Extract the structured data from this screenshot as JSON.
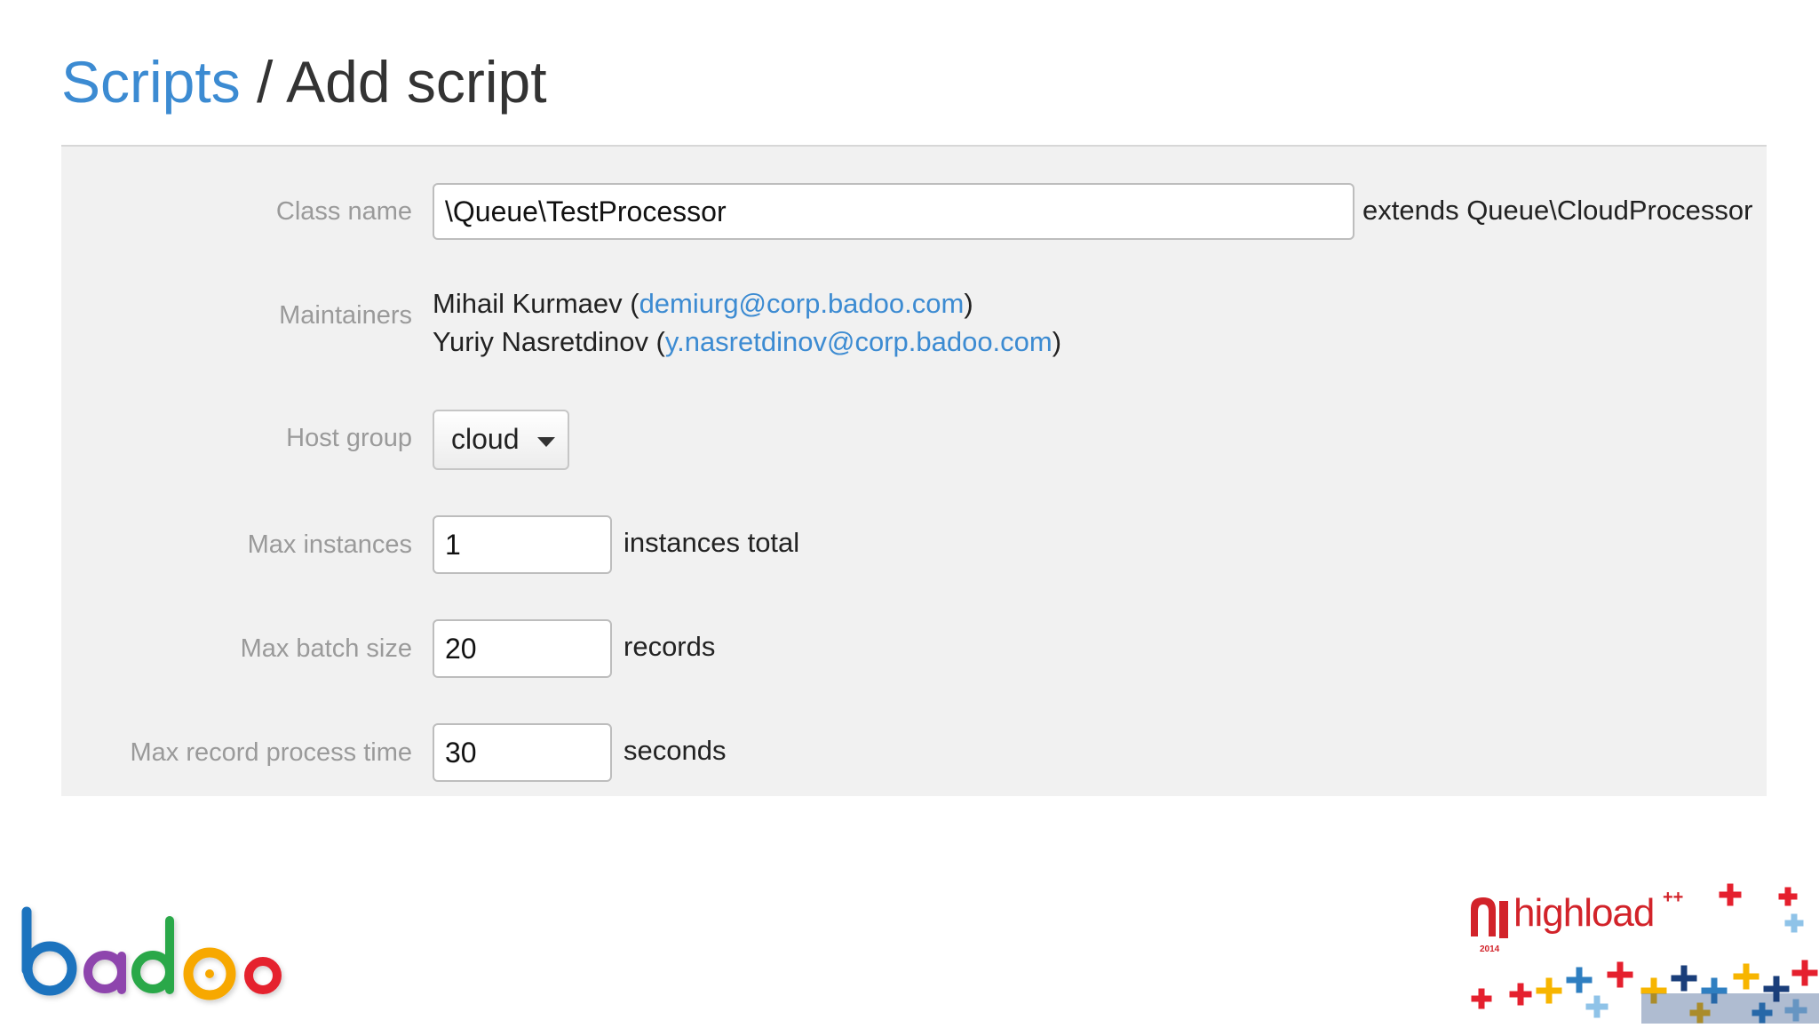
{
  "breadcrumb": {
    "parent": "Scripts",
    "separator": " / ",
    "current": "Add script"
  },
  "form": {
    "class_name": {
      "label": "Class name",
      "value": "\\Queue\\TestProcessor",
      "suffix": "extends Queue\\CloudProcessor"
    },
    "maintainers": {
      "label": "Maintainers",
      "items": [
        {
          "name": "Mihail Kurmaev (",
          "email": "demiurg@corp.badoo.com",
          "close": ")"
        },
        {
          "name": "Yuriy Nasretdinov (",
          "email": "y.nasretdinov@corp.badoo.com",
          "close": ")"
        }
      ]
    },
    "host_group": {
      "label": "Host group",
      "value": "cloud"
    },
    "max_instances": {
      "label": "Max instances",
      "value": "1",
      "suffix": "instances total"
    },
    "max_batch_size": {
      "label": "Max batch size",
      "value": "20",
      "suffix": "records"
    },
    "max_record_process_time": {
      "label": "Max record process time",
      "value": "30",
      "suffix": "seconds"
    }
  },
  "logos": {
    "badoo": {
      "text": "badoo",
      "colors": [
        "#1e73be",
        "#8e44ad",
        "#2ba84a",
        "#f7a800",
        "#e5202e"
      ]
    },
    "highload": {
      "text": "highload",
      "sup": "++",
      "year": "2014",
      "color": "#d2232a"
    }
  },
  "colors": {
    "link": "#3c8bd2",
    "panel": "#f1f1f1",
    "label": "#9a9a9a"
  }
}
